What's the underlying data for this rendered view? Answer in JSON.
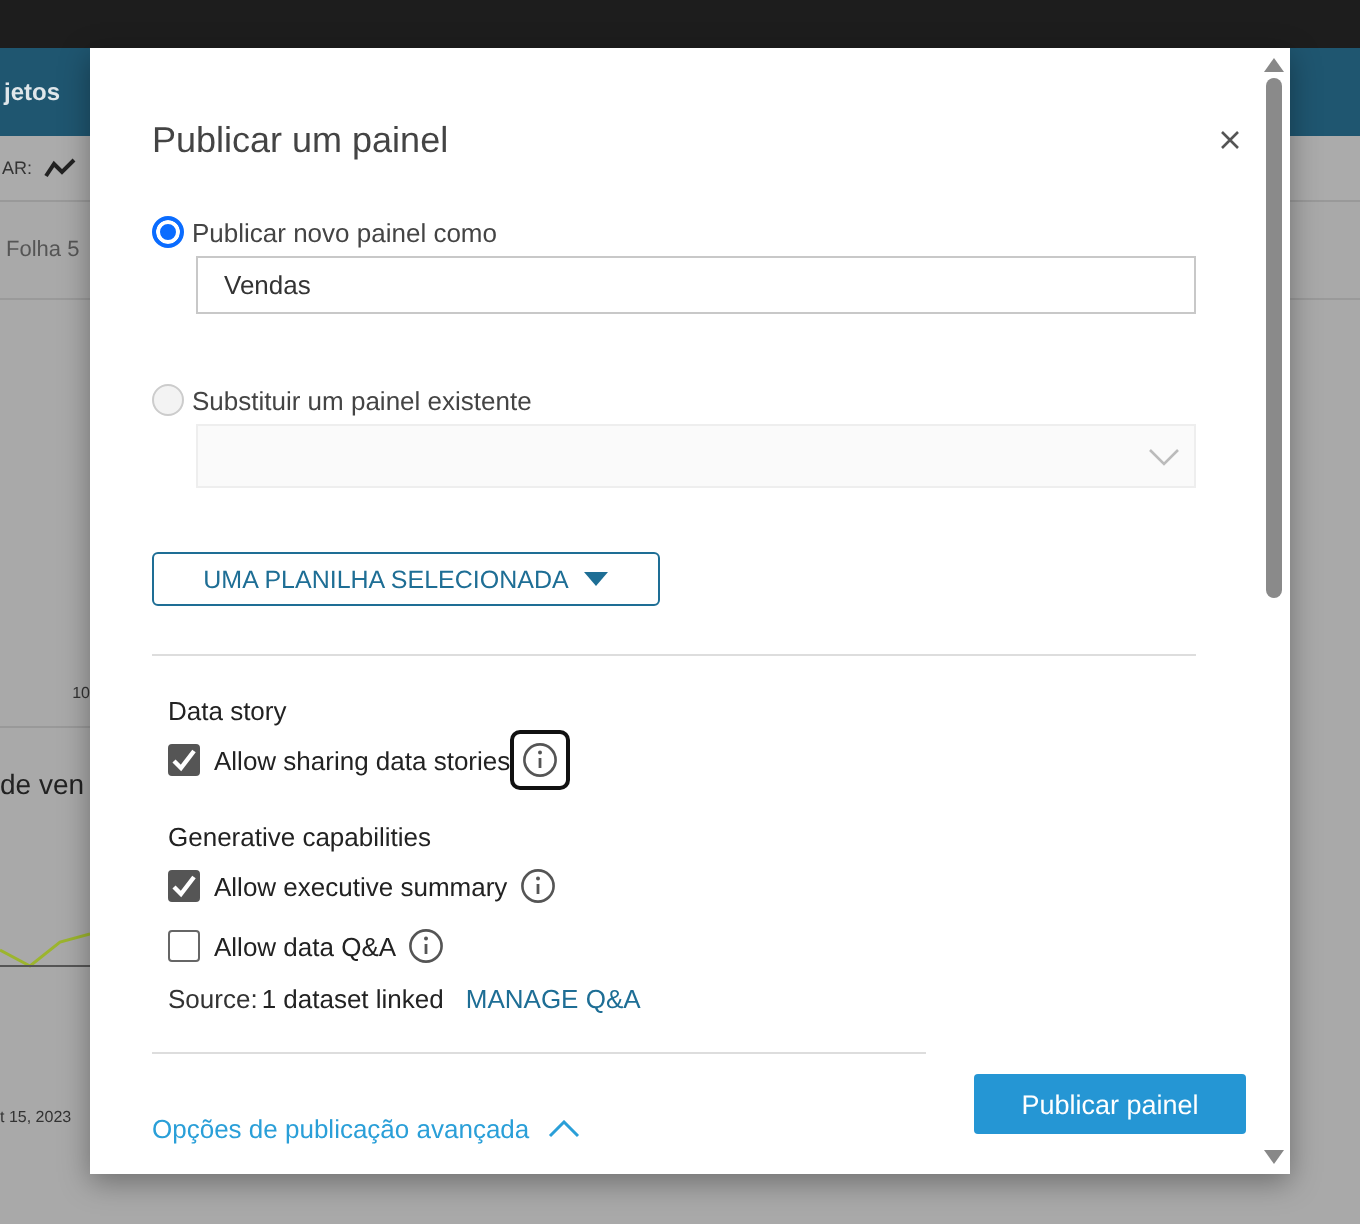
{
  "background": {
    "nav_tab": "jetos",
    "toolbar_label": "AR:",
    "sheet_tab": "Folha 5",
    "axis_label": "10",
    "chart_title": "de ven",
    "date_label": "t 15, 2023"
  },
  "dialog": {
    "title": "Publicar um painel",
    "options": [
      {
        "kind": "text",
        "label": "Publicar novo painel como",
        "selected": true,
        "value": "Vendas"
      },
      {
        "kind": "select",
        "label": "Substituir um painel existente",
        "selected": false
      }
    ],
    "sheet_button": "UMA PLANILHA SELECIONADA",
    "sections": [
      {
        "heading": "Data story",
        "items": [
          {
            "label": "Allow sharing data stories",
            "checked": true,
            "focused": true
          }
        ]
      },
      {
        "heading": "Generative capabilities",
        "items": [
          {
            "label": "Allow executive summary",
            "checked": true,
            "focused": false
          },
          {
            "label": "Allow data Q&A",
            "checked": false,
            "focused": false
          }
        ]
      }
    ],
    "source": {
      "label": "Source:",
      "value": "1 dataset linked",
      "link": "MANAGE Q&A"
    },
    "advanced_link": "Opções de publicação avançada",
    "advanced_expanded": true,
    "publish_button": "Publicar painel"
  }
}
